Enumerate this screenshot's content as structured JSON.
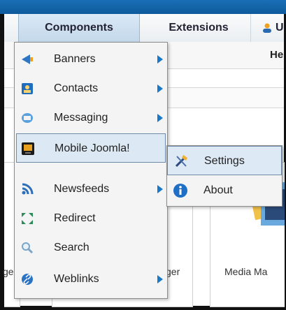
{
  "menubar": {
    "components_label": "Components",
    "extensions_label": "Extensions",
    "users_label": "U"
  },
  "secondbar": {
    "partial_text": "He"
  },
  "panels": {
    "left_label": "ge",
    "mid_label": "ger",
    "right_label": "Media Ma"
  },
  "dropdown": {
    "items": [
      {
        "label": "Banners",
        "icon": "banners-icon",
        "has_submenu": true
      },
      {
        "label": "Contacts",
        "icon": "contacts-icon",
        "has_submenu": true
      },
      {
        "label": "Messaging",
        "icon": "messaging-icon",
        "has_submenu": true
      },
      {
        "label": "Mobile Joomla!",
        "icon": "mobile-joomla-icon",
        "has_submenu": false
      },
      {
        "label": "Newsfeeds",
        "icon": "newsfeeds-icon",
        "has_submenu": true
      },
      {
        "label": "Redirect",
        "icon": "redirect-icon",
        "has_submenu": false
      },
      {
        "label": "Search",
        "icon": "search-icon",
        "has_submenu": false
      },
      {
        "label": "Weblinks",
        "icon": "weblinks-icon",
        "has_submenu": true
      }
    ]
  },
  "submenu": {
    "items": [
      {
        "label": "Settings",
        "icon": "settings-tools-icon"
      },
      {
        "label": "About",
        "icon": "info-icon"
      }
    ]
  },
  "colors": {
    "accent": "#1a78c8",
    "topbar": "#1a6fb6"
  }
}
